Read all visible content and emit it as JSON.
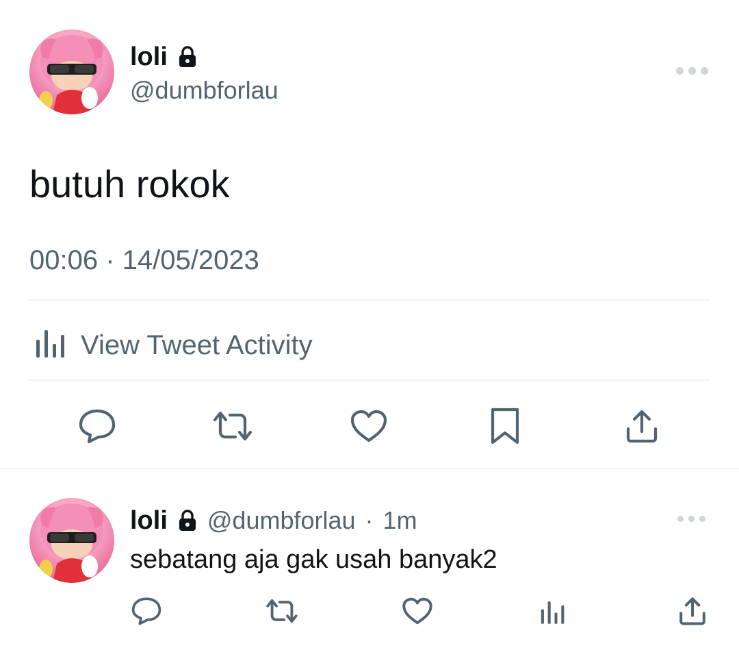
{
  "main_tweet": {
    "author_name": "loli",
    "author_handle": "@dumbforlau",
    "text": "butuh rokok",
    "time": "00:06",
    "separator": "·",
    "date": "14/05/2023",
    "activity_label": "View Tweet Activity"
  },
  "reply": {
    "author_name": "loli",
    "author_handle": "@dumbforlau",
    "separator": "·",
    "age": "1m",
    "text": "sebatang aja gak usah banyak2"
  },
  "icons": {
    "lock": "lock-icon",
    "more": "more-horizontal-icon",
    "analytics": "bar-chart-icon",
    "reply": "comment-icon",
    "retweet": "retweet-icon",
    "like": "heart-icon",
    "bookmark": "bookmark-icon",
    "share": "share-icon"
  },
  "colors": {
    "text_primary": "#0f1419",
    "text_secondary": "#536471",
    "divider": "#eff3f4"
  }
}
